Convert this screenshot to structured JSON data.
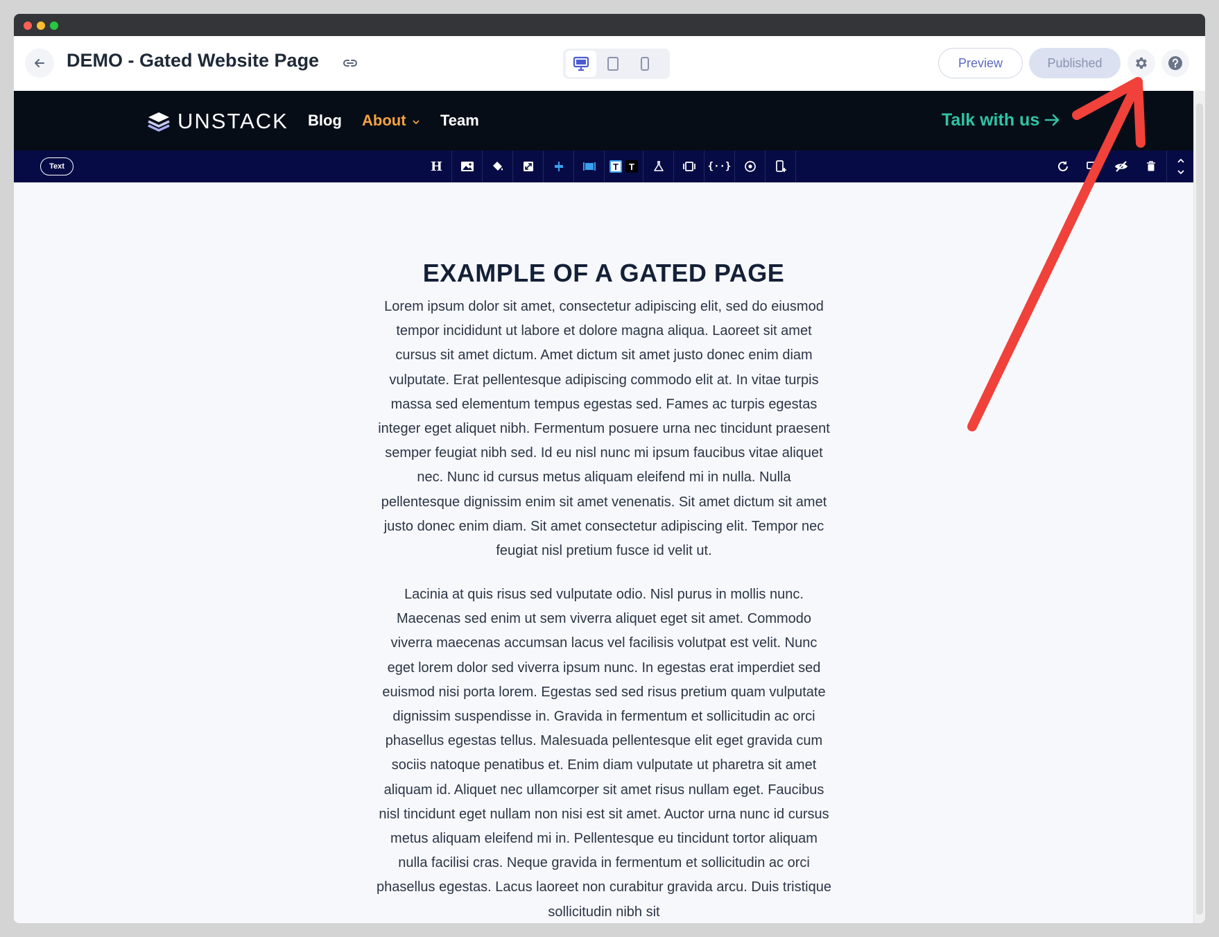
{
  "editor": {
    "page_title": "DEMO - Gated Website Page",
    "preview_label": "Preview",
    "published_label": "Published",
    "devices": [
      "desktop-icon",
      "tablet-icon",
      "mobile-icon"
    ],
    "active_device": "desktop"
  },
  "site_nav": {
    "logo_text": "UNSTACK",
    "items": [
      {
        "label": "Blog"
      },
      {
        "label": "About",
        "has_dropdown": true,
        "color": "#f5a340"
      },
      {
        "label": "Team"
      }
    ],
    "cta_label": "Talk with us",
    "cta_color": "#2ec4a6"
  },
  "section_toolbar": {
    "section_label": "Text",
    "tools": [
      "heading-icon",
      "image-icon",
      "fill-icon",
      "resize-icon",
      "align-icon",
      "width-icon",
      "text-color-light-icon",
      "text-color-dark-icon",
      "flask-icon",
      "frame-icon",
      "code-icon",
      "target-icon",
      "add-section-icon"
    ],
    "right_tools": [
      "refresh-icon",
      "duplicate-icon",
      "hide-icon",
      "delete-icon",
      "move-icon"
    ]
  },
  "content": {
    "headline": "EXAMPLE OF A GATED PAGE",
    "paragraphs": [
      "Lorem ipsum dolor sit amet, consectetur adipiscing elit, sed do eiusmod tempor incididunt ut labore et dolore magna aliqua. Laoreet sit amet cursus sit amet dictum. Amet dictum sit amet justo donec enim diam vulputate. Erat pellentesque adipiscing commodo elit at. In vitae turpis massa sed elementum tempus egestas sed. Fames ac turpis egestas integer eget aliquet nibh. Fermentum posuere urna nec tincidunt praesent semper feugiat nibh sed. Id eu nisl nunc mi ipsum faucibus vitae aliquet nec. Nunc id cursus metus aliquam eleifend mi in nulla. Nulla pellentesque dignissim enim sit amet venenatis. Sit amet dictum sit amet justo donec enim diam. Sit amet consectetur adipiscing elit. Tempor nec feugiat nisl pretium fusce id velit ut.",
      "Lacinia at quis risus sed vulputate odio. Nisl purus in mollis nunc. Maecenas sed enim ut sem viverra aliquet eget sit amet. Commodo viverra maecenas accumsan lacus vel facilisis volutpat est velit. Nunc eget lorem dolor sed viverra ipsum nunc. In egestas erat imperdiet sed euismod nisi porta lorem. Egestas sed sed risus pretium quam vulputate dignissim suspendisse in. Gravida in fermentum et sollicitudin ac orci phasellus egestas tellus. Malesuada pellentesque elit eget gravida cum sociis natoque penatibus et. Enim diam vulputate ut pharetra sit amet aliquam id. Aliquet nec ullamcorper sit amet risus nullam eget. Faucibus nisl tincidunt eget nullam non nisi est sit amet. Auctor urna nunc id cursus metus aliquam eleifend mi in. Pellentesque eu tincidunt tortor aliquam nulla facilisi cras. Neque gravida in fermentum et sollicitudin ac orci phasellus egestas. Lacus laoreet non curabitur gravida arcu. Duis tristique sollicitudin nibh sit"
    ]
  },
  "annotation": {
    "arrow_color": "#f0413a",
    "points_to": "settings-gear-icon"
  }
}
